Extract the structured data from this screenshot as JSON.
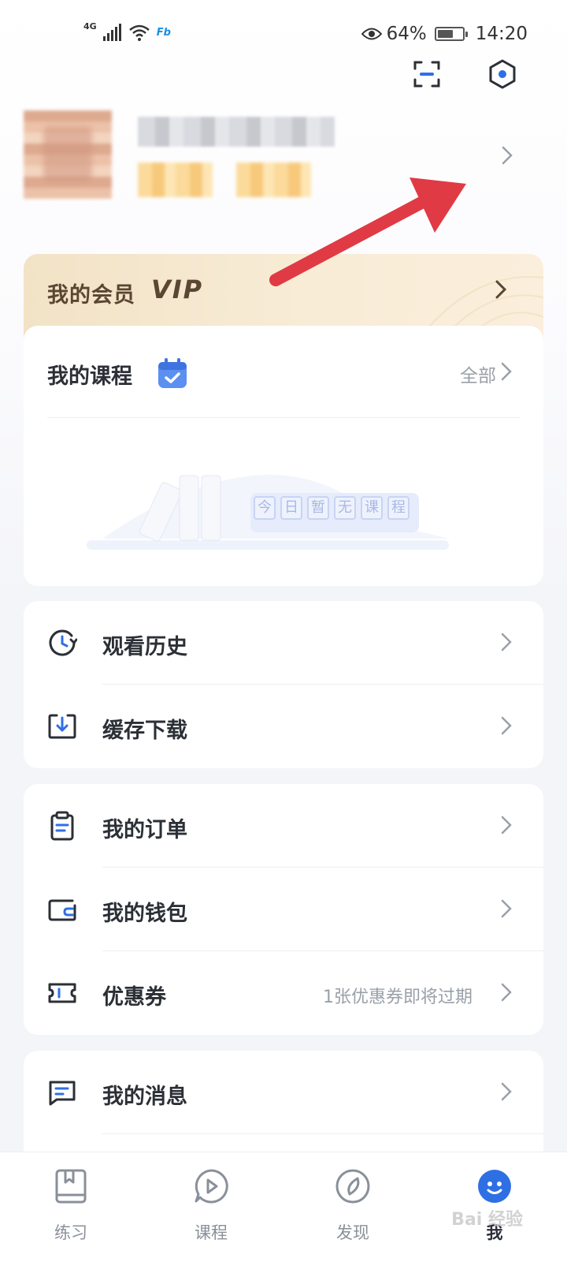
{
  "status_bar": {
    "network": "4G",
    "app_badge": "Fb",
    "battery_percent": "64%",
    "battery_level": 0.64,
    "time": "14:20"
  },
  "header": {
    "scan_icon": "scan-icon",
    "settings_icon": "hexagon-settings-icon"
  },
  "vip": {
    "title": "我的会员",
    "badge": "VIP"
  },
  "courses": {
    "title": "我的课程",
    "all_label": "全部",
    "empty_chars": [
      "今",
      "日",
      "暂",
      "无",
      "课",
      "程"
    ]
  },
  "group1": [
    {
      "label": "观看历史",
      "icon": "clock-history-icon"
    },
    {
      "label": "缓存下载",
      "icon": "download-icon"
    }
  ],
  "group2": [
    {
      "label": "我的订单",
      "icon": "clipboard-icon"
    },
    {
      "label": "我的钱包",
      "icon": "wallet-icon"
    },
    {
      "label": "优惠券",
      "icon": "ticket-icon",
      "extra": "1张优惠券即将过期"
    }
  ],
  "group3": [
    {
      "label": "我的消息",
      "icon": "message-icon"
    }
  ],
  "tabs": [
    {
      "label": "练习",
      "icon": "book-icon"
    },
    {
      "label": "课程",
      "icon": "play-bubble-icon"
    },
    {
      "label": "发现",
      "icon": "compass-icon"
    },
    {
      "label": "我",
      "icon": "profile-face-icon",
      "active": true
    }
  ],
  "colors": {
    "accent": "#2f6fe4",
    "vip_text": "#5a4632",
    "annotation_arrow": "#e03a44"
  },
  "watermark": "Bai 经验"
}
